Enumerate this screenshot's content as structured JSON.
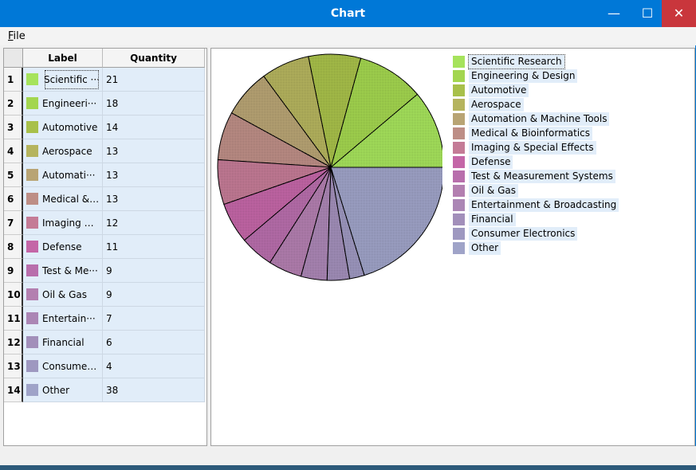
{
  "window": {
    "title": "Chart"
  },
  "titlebar_buttons": {
    "minimize": "—",
    "maximize": "☐",
    "close": "✕"
  },
  "menu": {
    "file_mnemonic": "F",
    "file_rest": "ile"
  },
  "table": {
    "headers": {
      "label": "Label",
      "quantity": "Quantity"
    },
    "rows": [
      {
        "num": "1",
        "label": "Scientific ···",
        "quantity": "21",
        "color": "#a6e35c"
      },
      {
        "num": "2",
        "label": "Engineeri···",
        "quantity": "18",
        "color": "#a3d64f"
      },
      {
        "num": "3",
        "label": "Automotive",
        "quantity": "14",
        "color": "#a8c04a"
      },
      {
        "num": "4",
        "label": "Aerospace",
        "quantity": "13",
        "color": "#b5b45e"
      },
      {
        "num": "5",
        "label": "Automati···",
        "quantity": "13",
        "color": "#b8a474"
      },
      {
        "num": "6",
        "label": "Medical & ···",
        "quantity": "13",
        "color": "#bd8e86"
      },
      {
        "num": "7",
        "label": "Imaging &···",
        "quantity": "12",
        "color": "#c47b96"
      },
      {
        "num": "8",
        "label": "Defense",
        "quantity": "11",
        "color": "#c466a7"
      },
      {
        "num": "9",
        "label": "Test & Me···",
        "quantity": "9",
        "color": "#b86eac"
      },
      {
        "num": "10",
        "label": "Oil & Gas",
        "quantity": "9",
        "color": "#b37fb0"
      },
      {
        "num": "11",
        "label": "Entertain···",
        "quantity": "7",
        "color": "#ab86b5"
      },
      {
        "num": "12",
        "label": "Financial",
        "quantity": "6",
        "color": "#a28fba"
      },
      {
        "num": "13",
        "label": "Consumer···",
        "quantity": "4",
        "color": "#9e98c0"
      },
      {
        "num": "14",
        "label": "Other",
        "quantity": "38",
        "color": "#9fa3c8"
      }
    ]
  },
  "chart_data": {
    "type": "pie",
    "categories": [
      "Scientific Research",
      "Engineering & Design",
      "Automotive",
      "Aerospace",
      "Automation & Machine Tools",
      "Medical & Bioinformatics",
      "Imaging & Special Effects",
      "Defense",
      "Test & Measurement Systems",
      "Oil & Gas",
      "Entertainment & Broadcasting",
      "Financial",
      "Consumer Electronics",
      "Other"
    ],
    "values": [
      21,
      18,
      14,
      13,
      13,
      13,
      12,
      11,
      9,
      9,
      7,
      6,
      4,
      38
    ],
    "colors": [
      "#a6e35c",
      "#a3d64f",
      "#a8c04a",
      "#b5b45e",
      "#b8a474",
      "#bd8e86",
      "#c47b96",
      "#c466a7",
      "#b86eac",
      "#b37fb0",
      "#ab86b5",
      "#a28fba",
      "#9e98c0",
      "#9fa3c8"
    ],
    "title": "",
    "legend": "right"
  }
}
